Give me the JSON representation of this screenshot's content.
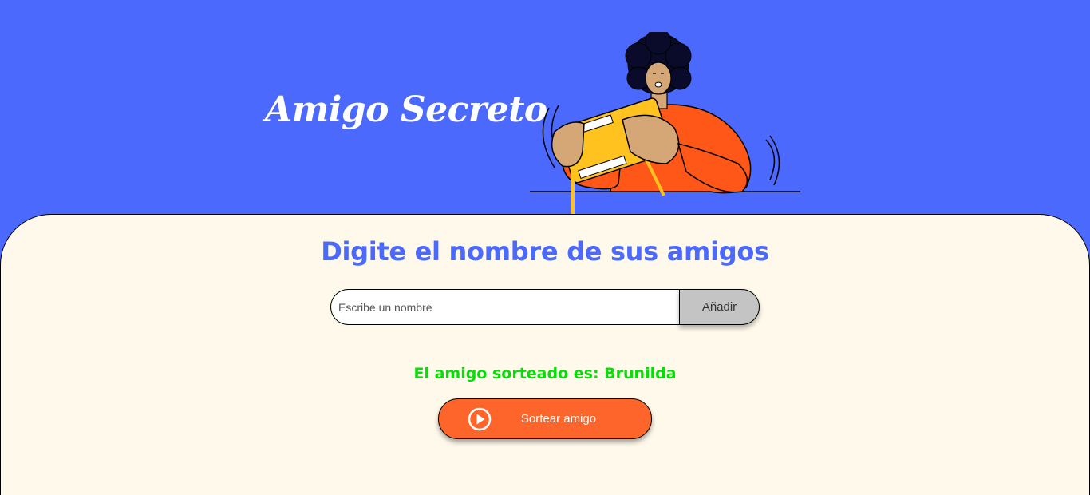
{
  "header": {
    "title": "Amigo Secreto",
    "illustration_icon": "person-playing-game-console"
  },
  "main": {
    "subtitle": "Digite el nombre de sus amigos",
    "input": {
      "placeholder": "Escribe un nombre",
      "value": ""
    },
    "add_button_label": "Añadir",
    "result_text": "El amigo sorteado es: Brunilda",
    "draw_button_label": "Sortear amigo",
    "draw_button_icon": "play-circle-icon"
  },
  "colors": {
    "header_bg": "#4B69FD",
    "main_bg": "#FFF9EB",
    "subtitle": "#4B69FD",
    "result": "#05DF05",
    "draw_button": "#FE652B",
    "add_button": "#C4C4C4"
  }
}
